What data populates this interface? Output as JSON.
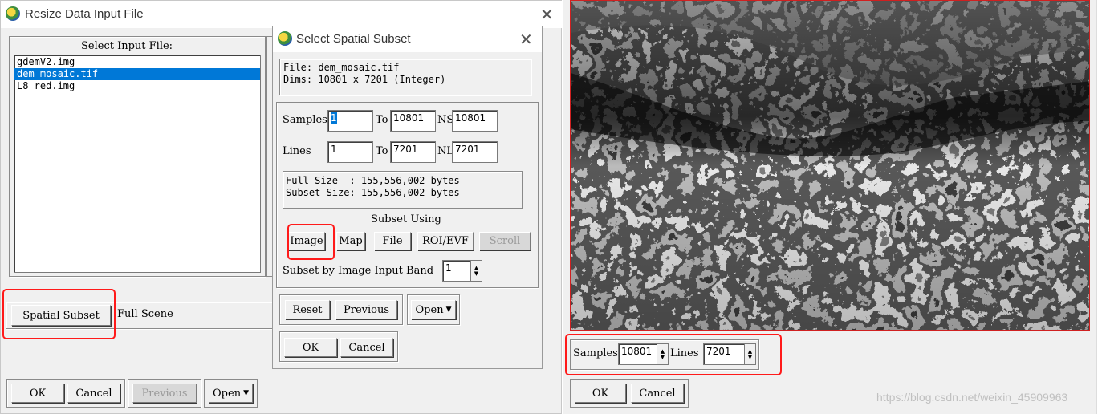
{
  "resize_window": {
    "title": "Resize Data Input File",
    "select_input_label": "Select Input File:",
    "files": [
      "gdemV2.img",
      "dem_mosaic.tif",
      "L8_red.img"
    ],
    "selected_index": 1,
    "spatial_subset_button": "Spatial Subset",
    "spatial_subset_value": "Full Scene",
    "ok_button": "OK",
    "cancel_button": "Cancel",
    "previous_button": "Previous",
    "open_button": "Open"
  },
  "subset_dialog": {
    "title": "Select Spatial Subset",
    "file_line": "File: dem_mosaic.tif",
    "dims_line": "Dims: 10801 x 7201 (Integer)",
    "samples_label": "Samples",
    "samples_from": "1",
    "to_label": "To",
    "samples_to": "10801",
    "ns_label": "NS",
    "ns_value": "10801",
    "lines_label": "Lines",
    "lines_from": "1",
    "lines_to": "7201",
    "nl_label": "NL",
    "nl_value": "7201",
    "full_size_line": "Full Size  : 155,556,002 bytes",
    "subset_size_line": "Subset Size: 155,556,002 bytes",
    "subset_using_label": "Subset Using",
    "image_button": "Image",
    "map_button": "Map",
    "file_button": "File",
    "roi_button": "ROI/EVF",
    "scroll_button": "Scroll",
    "band_label": "Subset by Image Input Band",
    "band_value": "1",
    "reset_button": "Reset",
    "previous_button": "Previous",
    "open_button": "Open",
    "ok_button": "OK",
    "cancel_button": "Cancel"
  },
  "image_window": {
    "samples_label": "Samples",
    "samples_value": "10801",
    "lines_label": "Lines",
    "lines_value": "7201",
    "ok_button": "OK",
    "cancel_button": "Cancel",
    "watermark": "https://blog.csdn.net/weixin_45909963"
  },
  "colors": {
    "highlight": "#ff1a1a",
    "selection": "#0078d7",
    "window_bg": "#f0f0f0"
  }
}
